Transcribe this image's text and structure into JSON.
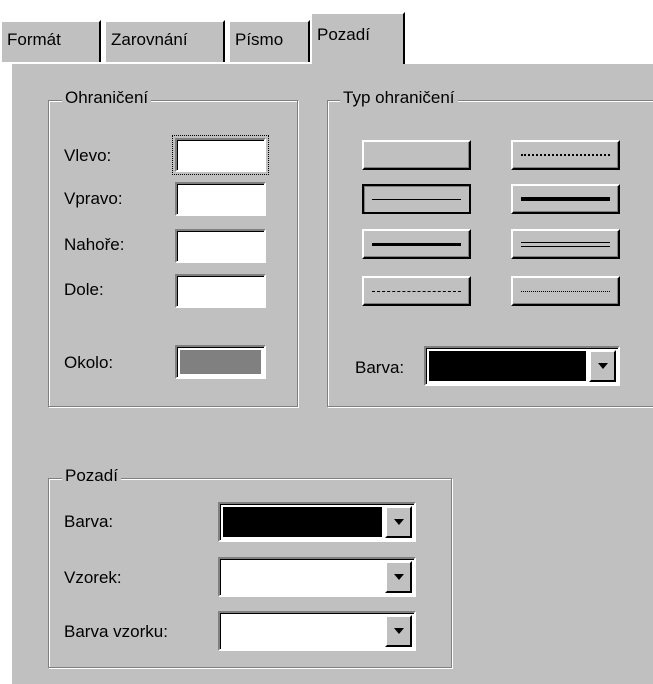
{
  "tabs": [
    {
      "label": "Formát",
      "active": false
    },
    {
      "label": "Zarovnání",
      "active": false
    },
    {
      "label": "Písmo",
      "active": false
    },
    {
      "label": "Pozadí",
      "active": true
    }
  ],
  "borders_group": {
    "title": "Ohraničení",
    "left_label": "Vlevo:",
    "right_label": "Vpravo:",
    "top_label": "Nahoře:",
    "bottom_label": "Dole:",
    "around_label": "Okolo:",
    "around_color": "#808080"
  },
  "border_type_group": {
    "title": "Typ ohraničení",
    "styles": [
      "none",
      "dotted-fine",
      "thin-selected",
      "thick",
      "medium",
      "double",
      "dashed",
      "dotted"
    ],
    "selected": "thin-selected",
    "color_label": "Barva:",
    "color_value": "#000000"
  },
  "background_group": {
    "title": "Pozadí",
    "color_label": "Barva:",
    "color_value": "#000000",
    "pattern_label": "Vzorek:",
    "pattern_color_label": "Barva vzorku:"
  }
}
